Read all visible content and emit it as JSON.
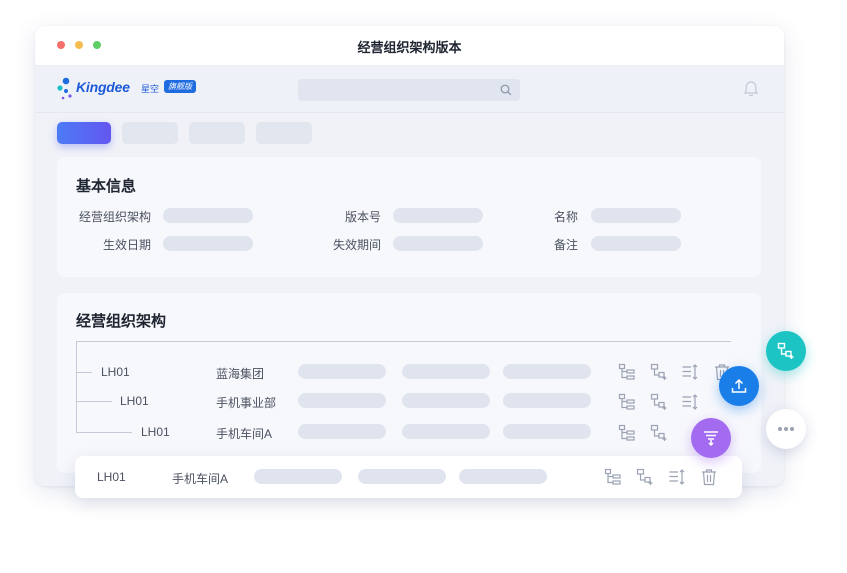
{
  "window": {
    "title": "经营组织架构版本"
  },
  "brand": {
    "name": "Kingdee",
    "sub": "星空",
    "badge": "旗舰版",
    "color": "#1f5bd8"
  },
  "colors": {
    "accent_start": "#4c7bf5",
    "accent_end": "#6356f0",
    "fab_teal": "#1cc4c4",
    "fab_blue": "#1a7ee8",
    "fab_purple": "#a36cf0"
  },
  "icons": [
    "search-icon",
    "bell-icon",
    "tree-structure-icon",
    "add-node-icon",
    "sort-icon",
    "delete-icon",
    "upload-icon",
    "filter-icon",
    "more-icon"
  ],
  "basic_info": {
    "title": "基本信息",
    "fields": [
      {
        "label": "经营组织架构"
      },
      {
        "label": "版本号"
      },
      {
        "label": "名称"
      },
      {
        "label": "生效日期"
      },
      {
        "label": "失效期间"
      },
      {
        "label": "备注"
      }
    ]
  },
  "org_structure": {
    "title": "经营组织架构",
    "rows": [
      {
        "code": "LH01",
        "name": "蓝海集团"
      },
      {
        "code": "LH01",
        "name": "手机事业部"
      },
      {
        "code": "LH01",
        "name": "手机车间A"
      }
    ]
  },
  "floating_row": {
    "code": "LH01",
    "name": "手机车间A"
  }
}
